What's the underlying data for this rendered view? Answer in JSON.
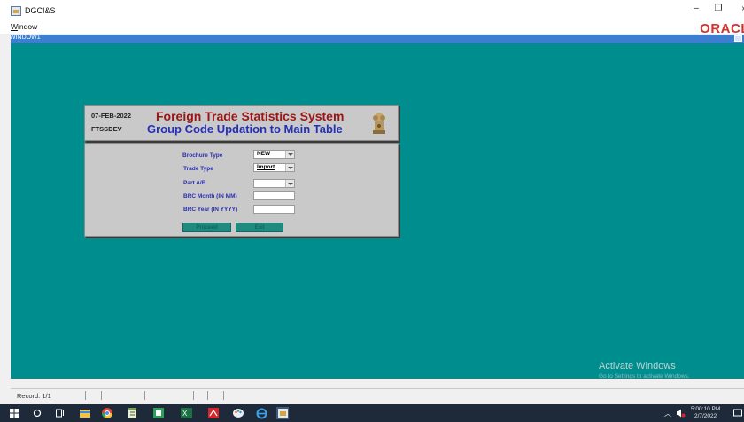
{
  "app": {
    "title": "DGCI&S",
    "brand": "ORACL"
  },
  "menu": {
    "window_prefix": "W",
    "window_rest": "indow"
  },
  "inner_window": {
    "title": "WINDOW1"
  },
  "header": {
    "date": "07-FEB-2022",
    "db": "FTSSDEV",
    "title1": "Foreign Trade Statistics System",
    "title2": "Group Code Updation to Main Table"
  },
  "form": {
    "brochure_type_label": "Brochure Type",
    "brochure_type_value": "NEW",
    "trade_type_label": "Trade Type",
    "trade_type_value": "Import",
    "trade_type_dots": " .....",
    "part_label": "Part A/B",
    "part_value": "",
    "brc_month_label": "BRC Month (IN MM)",
    "brc_month_value": "",
    "brc_year_label": "BRC Year (IN YYYY)",
    "brc_year_value": "",
    "proceed_label": "Proceed",
    "exit_label": "Exit"
  },
  "watermark": {
    "line1": "Activate Windows",
    "line2": "Go to Settings to activate Windows."
  },
  "status": {
    "record": "Record: 1/1"
  },
  "taskbar": {
    "time": "5:00:10 PM",
    "date": "2/7/2022"
  },
  "colors": {
    "canvas": "#008d8d",
    "header_title1": "#9c1414",
    "header_title2": "#2330b8",
    "label": "#2a2fb0",
    "button": "#1f8a80",
    "window_titlebar": "#3c7ed0",
    "oracle": "#d3342b"
  }
}
